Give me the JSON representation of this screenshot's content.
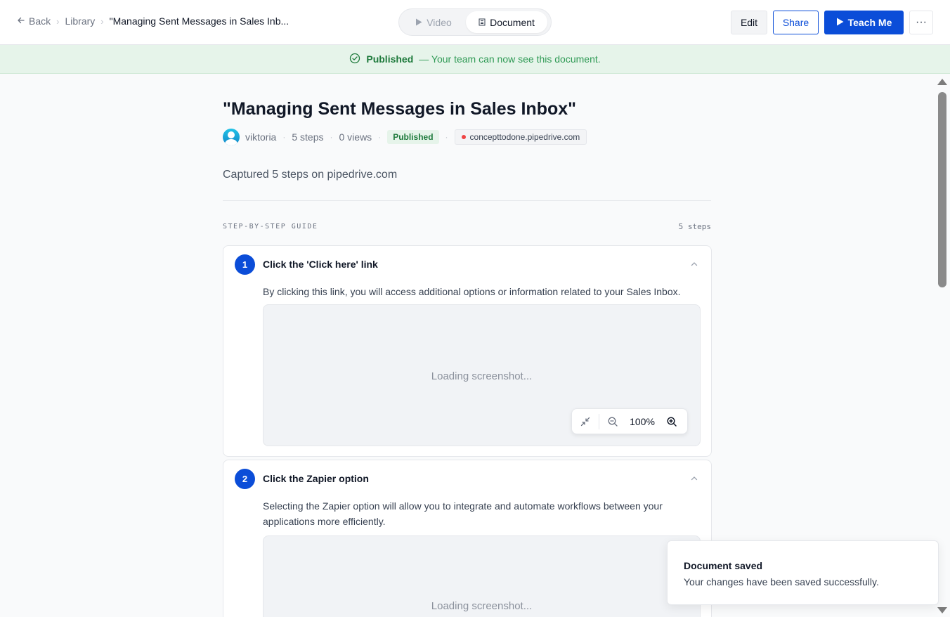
{
  "topbar": {
    "back_label": "Back",
    "breadcrumb_library": "Library",
    "breadcrumb_current": "\"Managing Sent Messages in Sales Inb...",
    "view_toggle": {
      "video_label": "Video",
      "document_label": "Document",
      "selected": "Document"
    },
    "edit_label": "Edit",
    "share_label": "Share",
    "teach_label": "Teach Me",
    "more_label": "···"
  },
  "banner": {
    "status": "Published",
    "message": "— Your team can now see this document."
  },
  "document": {
    "title": "\"Managing Sent Messages in Sales Inbox\"",
    "author": "viktoria",
    "steps_count": "5 steps",
    "views": "0 views",
    "status_badge": "Published",
    "domain": "concepttodone.pipedrive.com",
    "summary": "Captured 5 steps on pipedrive.com"
  },
  "guide": {
    "label": "STEP-BY-STEP GUIDE",
    "count": "5 steps",
    "steps": [
      {
        "number": "1",
        "title": "Click the 'Click here' link",
        "description": "By clicking this link, you will access additional options or information related to your Sales Inbox.",
        "screenshot_status": "Loading screenshot...",
        "zoom": "100%"
      },
      {
        "number": "2",
        "title": "Click the Zapier option",
        "description": "Selecting the Zapier option will allow you to integrate and automate workflows between your applications more efficiently.",
        "screenshot_status": "Loading screenshot..."
      }
    ]
  },
  "toast": {
    "title": "Document saved",
    "message": "Your changes have been saved successfully."
  },
  "colors": {
    "primary": "#0b4dd8",
    "banner_bg": "#e6f4ea",
    "success_text": "#1e7a3c"
  },
  "icons": [
    "arrow-left-icon",
    "chevron-right-icon",
    "play-icon",
    "document-icon",
    "check-circle-icon",
    "collapse-icon",
    "zoom-out-icon",
    "zoom-in-icon",
    "chevron-up-icon",
    "more-icon"
  ]
}
